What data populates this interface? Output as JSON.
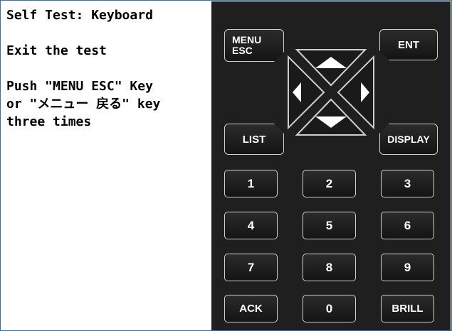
{
  "instructions": {
    "title": "Self Test: Keyboard",
    "subtitle": "Exit the test",
    "line1": "Push \"MENU ESC\" Key",
    "line2": "or \"メニュー 戻る\" key",
    "line3": "three times"
  },
  "keypad": {
    "menu_line1": "MENU",
    "menu_line2": "ESC",
    "ent": "ENT",
    "list": "LIST",
    "display": "DISPLAY",
    "keys": [
      "1",
      "2",
      "3",
      "4",
      "5",
      "6",
      "7",
      "8",
      "9"
    ],
    "ack": "ACK",
    "zero": "0",
    "brill": "BRILL",
    "dpad_icons": [
      "arrow-up-icon",
      "arrow-down-icon",
      "arrow-left-icon",
      "arrow-right-icon"
    ]
  },
  "colors": {
    "keypad_bg": "#1f1f1f",
    "key_border": "#cfcfcf",
    "key_text": "#ffffff",
    "screen_border": "#3a6ea8"
  }
}
